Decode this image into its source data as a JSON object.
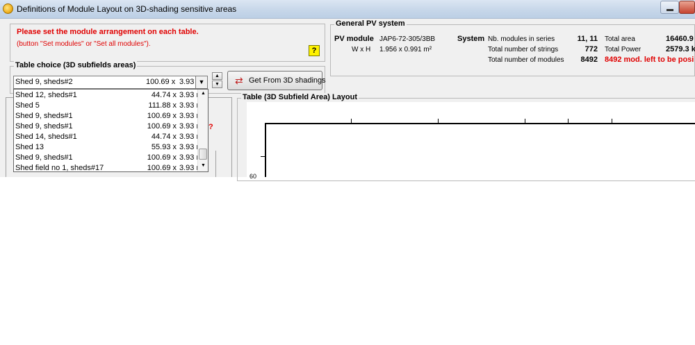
{
  "window": {
    "title": "Definitions of Module Layout on 3D-shading sensitive areas"
  },
  "warning": {
    "main": "Please set the module arrangement on each table.",
    "sub": "(button \"Set modules\" or \"Set all modules\")."
  },
  "help_label": "?",
  "general_pv": {
    "title": "General PV system",
    "pv_module_label": "PV module",
    "pv_module_value": "JAP6-72-305/3BB",
    "wxh_label": "W x H",
    "wxh_value": "1.956 x 0.991 m²",
    "system_label": "System",
    "nb_series_label": "Nb. modules in series",
    "nb_series_value": "11, 11",
    "strings_label": "Total number of strings",
    "strings_value": "772",
    "modules_label": "Total number of modules",
    "modules_value": "8492",
    "area_label": "Total area",
    "area_value": "16460.9",
    "power_label": "Total Power",
    "power_value": "2579.3 k",
    "left_to_position": "8492 mod. left to be posi"
  },
  "table_choice": {
    "title": "Table choice  (3D subfields areas)",
    "selected": "Shed 9, sheds#2",
    "selected_length": "100.69 x",
    "selected_width": "3.93",
    "get_button": "Get From 3D shadings",
    "items": [
      {
        "name": "Shed 12, sheds#1",
        "length": "44.74 x",
        "width": "3.93 r"
      },
      {
        "name": "Shed 5",
        "length": "111.88 x",
        "width": "3.93 r"
      },
      {
        "name": "Shed 9, sheds#1",
        "length": "100.69 x",
        "width": "3.93 r"
      },
      {
        "name": "Shed 9, sheds#1",
        "length": "100.69 x",
        "width": "3.93 r"
      },
      {
        "name": "Shed 14, sheds#1",
        "length": "44.74 x",
        "width": "3.93 r"
      },
      {
        "name": "Shed 13",
        "length": "55.93 x",
        "width": "3.93 r"
      },
      {
        "name": "Shed 9, sheds#1",
        "length": "100.69 x",
        "width": "3.93 r"
      },
      {
        "name": "Shed field no 1, sheds#17",
        "length": "100.69 x",
        "width": "3.93 r"
      }
    ]
  },
  "layout": {
    "title": "Table (3D Subfield Area) Layout",
    "y_tick_label": "60"
  },
  "colors": {
    "warning": "#e00000",
    "help_bg": "#fff200"
  }
}
